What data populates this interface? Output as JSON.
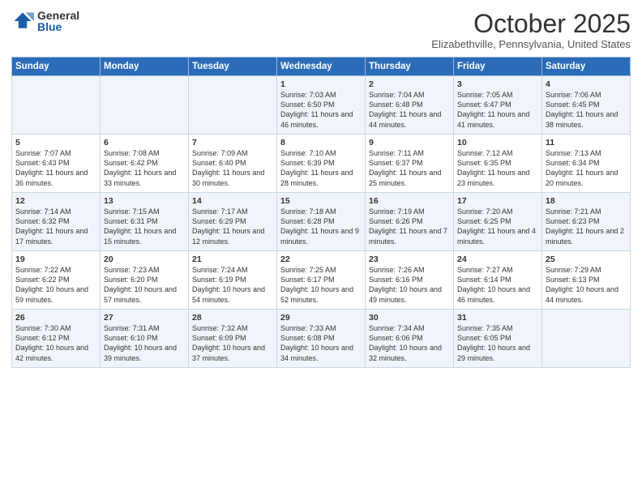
{
  "logo": {
    "general": "General",
    "blue": "Blue"
  },
  "title": "October 2025",
  "location": "Elizabethville, Pennsylvania, United States",
  "days_header": [
    "Sunday",
    "Monday",
    "Tuesday",
    "Wednesday",
    "Thursday",
    "Friday",
    "Saturday"
  ],
  "weeks": [
    [
      {
        "day": "",
        "info": ""
      },
      {
        "day": "",
        "info": ""
      },
      {
        "day": "",
        "info": ""
      },
      {
        "day": "1",
        "info": "Sunrise: 7:03 AM\nSunset: 6:50 PM\nDaylight: 11 hours and 46 minutes."
      },
      {
        "day": "2",
        "info": "Sunrise: 7:04 AM\nSunset: 6:48 PM\nDaylight: 11 hours and 44 minutes."
      },
      {
        "day": "3",
        "info": "Sunrise: 7:05 AM\nSunset: 6:47 PM\nDaylight: 11 hours and 41 minutes."
      },
      {
        "day": "4",
        "info": "Sunrise: 7:06 AM\nSunset: 6:45 PM\nDaylight: 11 hours and 38 minutes."
      }
    ],
    [
      {
        "day": "5",
        "info": "Sunrise: 7:07 AM\nSunset: 6:43 PM\nDaylight: 11 hours and 36 minutes."
      },
      {
        "day": "6",
        "info": "Sunrise: 7:08 AM\nSunset: 6:42 PM\nDaylight: 11 hours and 33 minutes."
      },
      {
        "day": "7",
        "info": "Sunrise: 7:09 AM\nSunset: 6:40 PM\nDaylight: 11 hours and 30 minutes."
      },
      {
        "day": "8",
        "info": "Sunrise: 7:10 AM\nSunset: 6:39 PM\nDaylight: 11 hours and 28 minutes."
      },
      {
        "day": "9",
        "info": "Sunrise: 7:11 AM\nSunset: 6:37 PM\nDaylight: 11 hours and 25 minutes."
      },
      {
        "day": "10",
        "info": "Sunrise: 7:12 AM\nSunset: 6:35 PM\nDaylight: 11 hours and 23 minutes."
      },
      {
        "day": "11",
        "info": "Sunrise: 7:13 AM\nSunset: 6:34 PM\nDaylight: 11 hours and 20 minutes."
      }
    ],
    [
      {
        "day": "12",
        "info": "Sunrise: 7:14 AM\nSunset: 6:32 PM\nDaylight: 11 hours and 17 minutes."
      },
      {
        "day": "13",
        "info": "Sunrise: 7:15 AM\nSunset: 6:31 PM\nDaylight: 11 hours and 15 minutes."
      },
      {
        "day": "14",
        "info": "Sunrise: 7:17 AM\nSunset: 6:29 PM\nDaylight: 11 hours and 12 minutes."
      },
      {
        "day": "15",
        "info": "Sunrise: 7:18 AM\nSunset: 6:28 PM\nDaylight: 11 hours and 9 minutes."
      },
      {
        "day": "16",
        "info": "Sunrise: 7:19 AM\nSunset: 6:26 PM\nDaylight: 11 hours and 7 minutes."
      },
      {
        "day": "17",
        "info": "Sunrise: 7:20 AM\nSunset: 6:25 PM\nDaylight: 11 hours and 4 minutes."
      },
      {
        "day": "18",
        "info": "Sunrise: 7:21 AM\nSunset: 6:23 PM\nDaylight: 11 hours and 2 minutes."
      }
    ],
    [
      {
        "day": "19",
        "info": "Sunrise: 7:22 AM\nSunset: 6:22 PM\nDaylight: 10 hours and 59 minutes."
      },
      {
        "day": "20",
        "info": "Sunrise: 7:23 AM\nSunset: 6:20 PM\nDaylight: 10 hours and 57 minutes."
      },
      {
        "day": "21",
        "info": "Sunrise: 7:24 AM\nSunset: 6:19 PM\nDaylight: 10 hours and 54 minutes."
      },
      {
        "day": "22",
        "info": "Sunrise: 7:25 AM\nSunset: 6:17 PM\nDaylight: 10 hours and 52 minutes."
      },
      {
        "day": "23",
        "info": "Sunrise: 7:26 AM\nSunset: 6:16 PM\nDaylight: 10 hours and 49 minutes."
      },
      {
        "day": "24",
        "info": "Sunrise: 7:27 AM\nSunset: 6:14 PM\nDaylight: 10 hours and 46 minutes."
      },
      {
        "day": "25",
        "info": "Sunrise: 7:29 AM\nSunset: 6:13 PM\nDaylight: 10 hours and 44 minutes."
      }
    ],
    [
      {
        "day": "26",
        "info": "Sunrise: 7:30 AM\nSunset: 6:12 PM\nDaylight: 10 hours and 42 minutes."
      },
      {
        "day": "27",
        "info": "Sunrise: 7:31 AM\nSunset: 6:10 PM\nDaylight: 10 hours and 39 minutes."
      },
      {
        "day": "28",
        "info": "Sunrise: 7:32 AM\nSunset: 6:09 PM\nDaylight: 10 hours and 37 minutes."
      },
      {
        "day": "29",
        "info": "Sunrise: 7:33 AM\nSunset: 6:08 PM\nDaylight: 10 hours and 34 minutes."
      },
      {
        "day": "30",
        "info": "Sunrise: 7:34 AM\nSunset: 6:06 PM\nDaylight: 10 hours and 32 minutes."
      },
      {
        "day": "31",
        "info": "Sunrise: 7:35 AM\nSunset: 6:05 PM\nDaylight: 10 hours and 29 minutes."
      },
      {
        "day": "",
        "info": ""
      }
    ]
  ]
}
